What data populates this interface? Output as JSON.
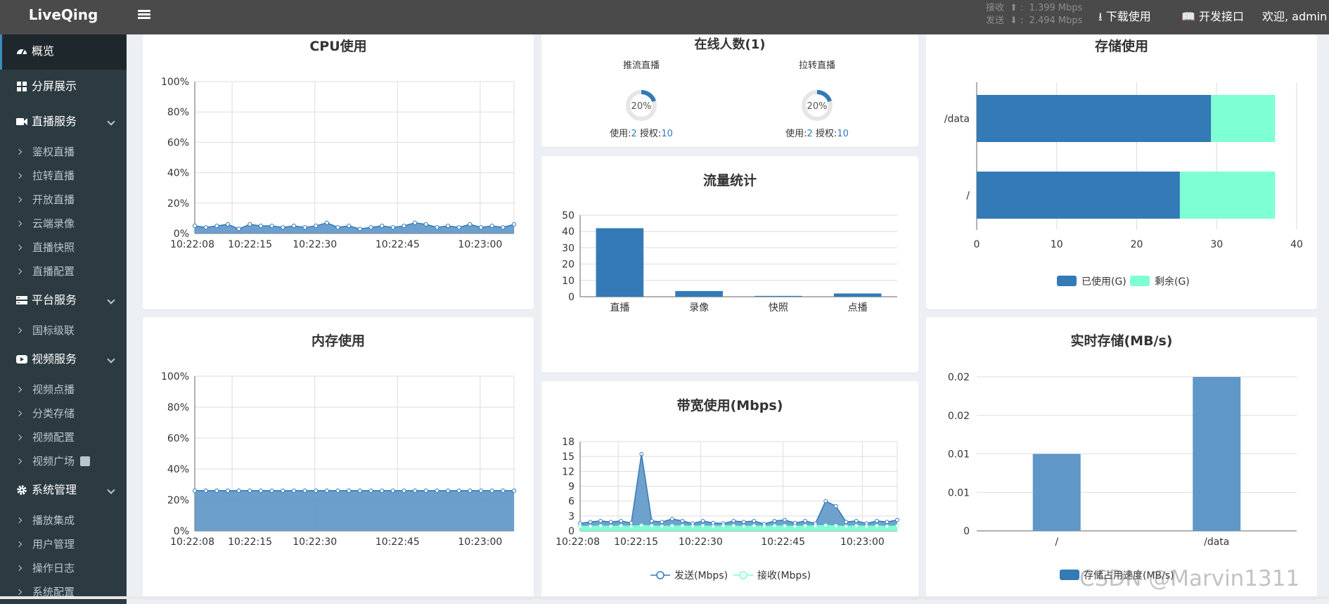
{
  "app": {
    "logo": "LiveQing"
  },
  "header": {
    "net_recv_label": "接收",
    "net_recv_value": "1.399 Mbps",
    "net_send_label": "发送",
    "net_send_value": "2.494 Mbps",
    "download": "下载使用",
    "api": "开发接口",
    "welcome": "欢迎, admin"
  },
  "sidebar": {
    "overview": "概览",
    "split": "分屏展示",
    "live": "直播服务",
    "live_items": [
      "鉴权直播",
      "拉转直播",
      "开放直播",
      "云端录像",
      "直播快照",
      "直播配置"
    ],
    "platform": "平台服务",
    "platform_items": [
      "国标级联"
    ],
    "video": "视频服务",
    "video_items": [
      "视频点播",
      "分类存储",
      "视频配置",
      "视频广场"
    ],
    "system": "系统管理",
    "system_items": [
      "播放集成",
      "用户管理",
      "操作日志",
      "系统配置"
    ]
  },
  "colors": {
    "primary": "#337ab7",
    "mint": "#7fffd4",
    "sidebar": "#222d32",
    "topbar": "#4a4a4a"
  },
  "chart_data": [
    {
      "type": "area",
      "title": "CPU使用",
      "yticks": [
        "0%",
        "20%",
        "40%",
        "60%",
        "80%",
        "100%"
      ],
      "ylim": [
        0,
        100
      ],
      "xticks": [
        "10:22:08",
        "10:22:15",
        "10:22:30",
        "10:22:45",
        "10:23:00"
      ],
      "values": [
        5,
        4,
        5,
        6,
        3,
        6,
        5,
        5,
        4,
        5,
        4,
        5,
        7,
        4,
        5,
        3,
        4,
        5,
        4,
        5,
        7,
        6,
        4,
        5,
        4,
        6,
        4,
        5,
        4,
        6
      ]
    },
    {
      "type": "area",
      "title": "内存使用",
      "yticks": [
        "0%",
        "20%",
        "40%",
        "60%",
        "80%",
        "100%"
      ],
      "ylim": [
        0,
        100
      ],
      "xticks": [
        "10:22:08",
        "10:22:15",
        "10:22:30",
        "10:22:45",
        "10:23:00"
      ],
      "values": [
        26,
        26,
        26,
        26,
        26,
        26,
        26,
        26,
        26,
        26,
        26,
        26,
        26,
        26,
        26,
        26,
        26,
        26,
        26,
        26,
        26,
        26,
        26,
        26,
        26,
        26,
        26,
        26,
        26,
        26
      ]
    },
    {
      "type": "pie",
      "title": "在线人数(1)",
      "gauges": [
        {
          "name": "推流直播",
          "percent": 20,
          "label": "20%",
          "used_label": "使用:",
          "used": "2",
          "auth_label": "授权:",
          "auth": "10"
        },
        {
          "name": "拉转直播",
          "percent": 20,
          "label": "20%",
          "used_label": "使用:",
          "used": "2",
          "auth_label": "授权:",
          "auth": "10"
        }
      ]
    },
    {
      "type": "bar",
      "title": "流量统计",
      "categories": [
        "直播",
        "录像",
        "快照",
        "点播"
      ],
      "values": [
        42,
        3.5,
        0.5,
        2
      ],
      "yticks": [
        "0",
        "10",
        "20",
        "30",
        "40",
        "50"
      ],
      "ylim": [
        0,
        50
      ]
    },
    {
      "type": "line",
      "title": "带宽使用(Mbps)",
      "yticks": [
        "0",
        "3",
        "6",
        "9",
        "12",
        "15",
        "18"
      ],
      "ylim": [
        0,
        18
      ],
      "xticks": [
        "10:22:08",
        "10:22:15",
        "10:22:30",
        "10:22:45",
        "10:23:00"
      ],
      "series": [
        {
          "name": "发送(Mbps)",
          "values": [
            1.5,
            1.8,
            2,
            1.8,
            2,
            1.6,
            15.5,
            2,
            1.8,
            2.4,
            2,
            1.5,
            2,
            1.6,
            1.5,
            2,
            1.8,
            2,
            1.4,
            2,
            2.2,
            1.6,
            2,
            1.5,
            6,
            5,
            1.8,
            2,
            1.5,
            2,
            1.8,
            2.2
          ]
        },
        {
          "name": "接收(Mbps)",
          "values": [
            0.9,
            0.9,
            1,
            0.9,
            1,
            0.9,
            1.1,
            1,
            0.9,
            1,
            1,
            0.9,
            1,
            0.9,
            1,
            1,
            0.9,
            1,
            0.9,
            1,
            1,
            0.9,
            1,
            1,
            1.1,
            1,
            0.9,
            1,
            0.9,
            1,
            0.9,
            1
          ]
        }
      ]
    },
    {
      "type": "bar",
      "title": "存储使用",
      "orientation": "horizontal",
      "categories": [
        "/data",
        "/"
      ],
      "series": [
        {
          "name": "已使用(G)",
          "values": [
            29.3,
            25.4
          ]
        },
        {
          "name": "剩余(G)",
          "values": [
            8,
            11.9
          ]
        }
      ],
      "xticks": [
        "0",
        "10",
        "20",
        "30",
        "40"
      ],
      "xlim": [
        0,
        40
      ]
    },
    {
      "type": "bar",
      "title": "实时存储(MB/s)",
      "categories": [
        "/",
        "/data"
      ],
      "series": [
        {
          "name": "存储占用速度(MB/s)",
          "values": [
            0.01,
            0.02
          ]
        }
      ],
      "yticks": [
        "0",
        "0.01",
        "0.01",
        "0.02",
        "0.02"
      ],
      "ylim": [
        0,
        0.02
      ]
    }
  ],
  "watermark": "CSDN @Marvin1311"
}
